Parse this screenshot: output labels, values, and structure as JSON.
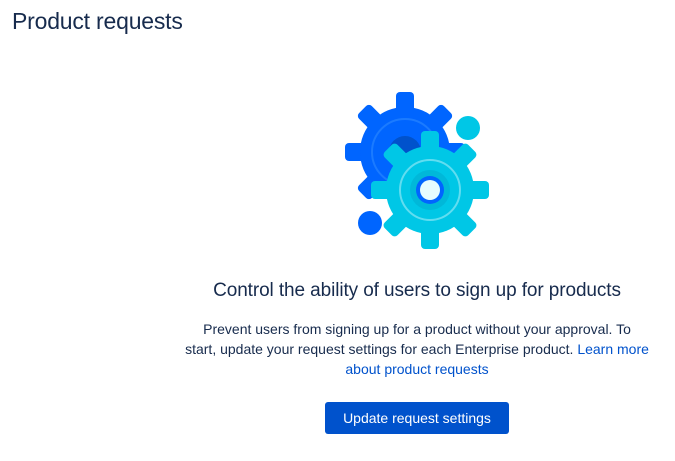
{
  "page": {
    "title": "Product requests"
  },
  "empty_state": {
    "illustration_icon": "gears-icon",
    "heading": "Control the ability of users to sign up for products",
    "description_line1": "Prevent users from signing up for a product without your approval. To",
    "description_line2": "start, update your request settings for each Enterprise product. ",
    "learn_more_link": "Learn more about product requests",
    "button_label": "Update request settings"
  },
  "colors": {
    "primary": "#0052CC",
    "text": "#172B4D",
    "gear_dark": "#0065FF",
    "gear_light": "#00C7E6"
  }
}
